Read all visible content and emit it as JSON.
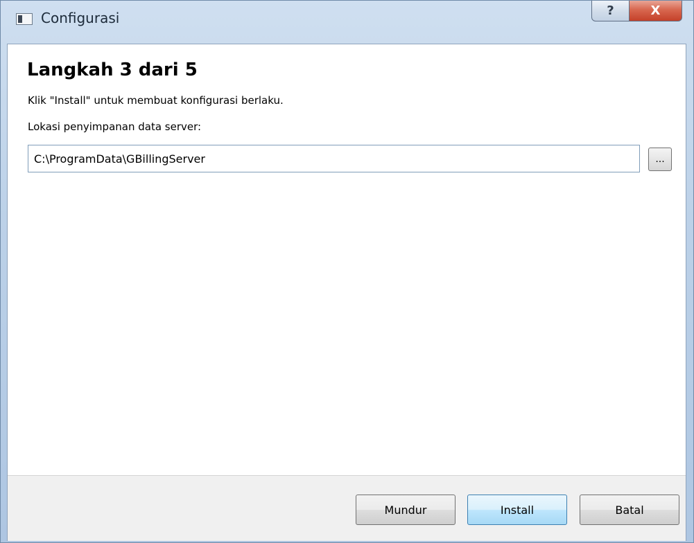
{
  "window": {
    "title": "Configurasi",
    "help_glyph": "?",
    "close_glyph": "X"
  },
  "wizard": {
    "heading": "Langkah 3 dari 5",
    "subtitle": "Klik \"Install\" untuk membuat konfigurasi berlaku.",
    "field_label": "Lokasi penyimpanan data server:",
    "path_value": "C:\\ProgramData\\GBillingServer",
    "browse_label": "..."
  },
  "buttons": {
    "back": "Mundur",
    "install": "Install",
    "cancel": "Batal"
  },
  "colors": {
    "close_button": "#c4412a",
    "default_button_accent": "#3c7fb1"
  },
  "icons": {
    "app": "app-window-icon",
    "help": "help-icon",
    "close": "close-icon"
  }
}
